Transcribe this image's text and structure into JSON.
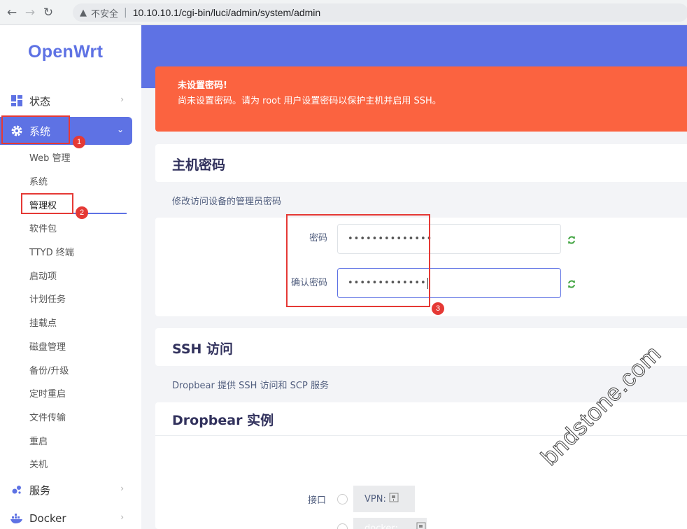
{
  "browser": {
    "back_icon": "←",
    "forward_icon": "→",
    "reload_icon": "↻",
    "warning_icon": "▲",
    "insecure_label": "不安全",
    "url": "10.10.10.1/cgi-bin/luci/admin/system/admin"
  },
  "sidebar": {
    "logo": "OpenWrt",
    "menu": {
      "status": {
        "label": "状态",
        "icon": "dashboard-icon"
      },
      "system": {
        "label": "系统",
        "icon": "gear-icon"
      },
      "services": {
        "label": "服务",
        "icon": "puzzle-icon"
      },
      "docker": {
        "label": "Docker",
        "icon": "docker-icon"
      }
    },
    "arrow_right": "›",
    "arrow_down": "⌄",
    "submenu": [
      "Web 管理",
      "系统",
      "管理权",
      "软件包",
      "TTYD 终端",
      "启动项",
      "计划任务",
      "挂载点",
      "磁盘管理",
      "备份/升级",
      "定时重启",
      "文件传输",
      "重启",
      "关机"
    ]
  },
  "annotations": {
    "badge1": "1",
    "badge2": "2",
    "badge3": "3"
  },
  "alert": {
    "title": "未设置密码!",
    "message": "尚未设置密码。请为 root 用户设置密码以保护主机并启用 SSH。"
  },
  "password_section": {
    "title": "主机密码",
    "description": "修改访问设备的管理员密码",
    "password_label": "密码",
    "password_value": "••••••••••••••",
    "confirm_label": "确认密码",
    "confirm_value": "•••••••••••••"
  },
  "ssh_section": {
    "title": "SSH 访问",
    "description": "Dropbear 提供 SSH 访问和 SCP 服务"
  },
  "dropbear_section": {
    "title": "Dropbear 实例",
    "interface_label": "接口",
    "iface_vpn": "VPN:",
    "iface_docker": "docker:"
  },
  "watermark": "bndstone.com",
  "colors": {
    "primary": "#5e72e4",
    "alert": "#fb6340",
    "annotation": "#e53935"
  }
}
